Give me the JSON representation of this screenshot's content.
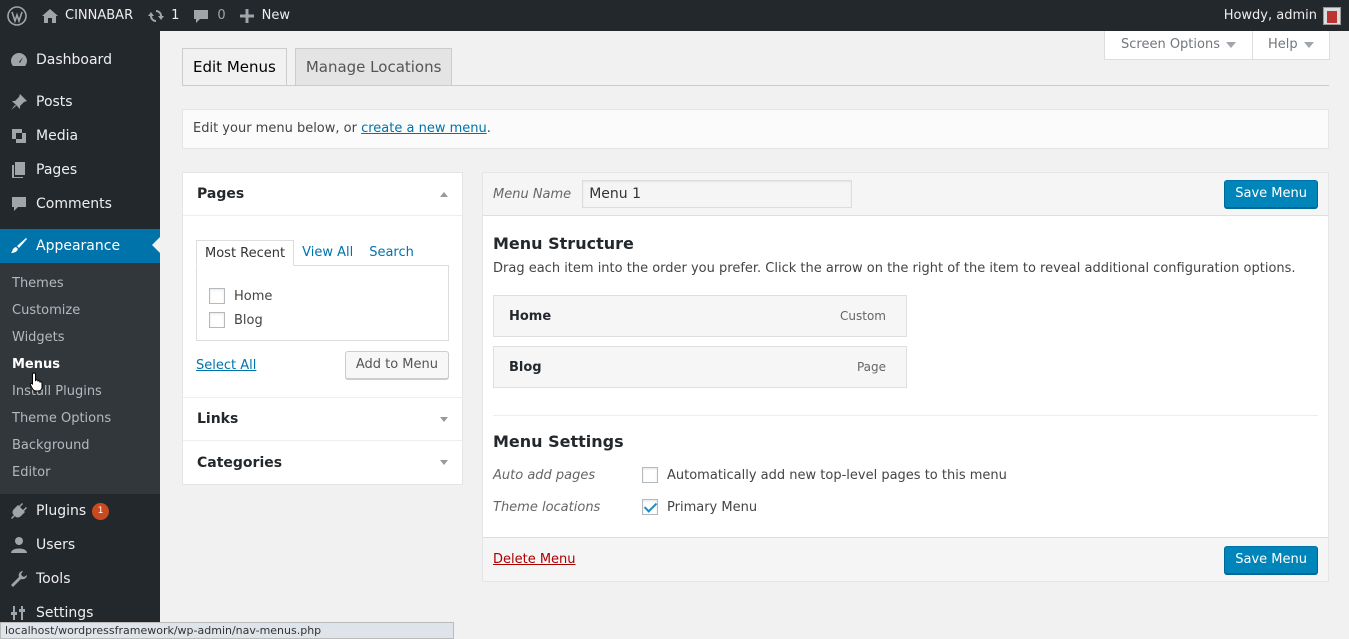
{
  "adminbar": {
    "site_name": "CINNABAR",
    "updates_count": "1",
    "comments_count": "0",
    "new_label": "New",
    "howdy": "Howdy, admin"
  },
  "sidebar": {
    "items": [
      {
        "label": "Dashboard",
        "icon": "dashboard-icon"
      },
      {
        "label": "Posts",
        "icon": "pin-icon"
      },
      {
        "label": "Media",
        "icon": "media-icon"
      },
      {
        "label": "Pages",
        "icon": "pages-icon"
      },
      {
        "label": "Comments",
        "icon": "comment-icon"
      },
      {
        "label": "Appearance",
        "icon": "brush-icon"
      },
      {
        "label": "Plugins",
        "icon": "plugin-icon",
        "badge": "1"
      },
      {
        "label": "Users",
        "icon": "users-icon"
      },
      {
        "label": "Tools",
        "icon": "wrench-icon"
      },
      {
        "label": "Settings",
        "icon": "settings-icon"
      }
    ],
    "submenu": [
      "Themes",
      "Customize",
      "Widgets",
      "Menus",
      "Install Plugins",
      "Theme Options",
      "Background",
      "Editor"
    ]
  },
  "tabs": {
    "edit": "Edit Menus",
    "locations": "Manage Locations"
  },
  "screen_options": "Screen Options",
  "help": "Help",
  "notice": {
    "text": "Edit your menu below, or ",
    "link": "create a new menu",
    "end": "."
  },
  "left": {
    "pages_title": "Pages",
    "tabs": [
      "Most Recent",
      "View All",
      "Search"
    ],
    "pages": [
      "Home",
      "Blog"
    ],
    "select_all": "Select All",
    "add_to_menu": "Add to Menu",
    "links_title": "Links",
    "categories_title": "Categories"
  },
  "menu": {
    "name_label": "Menu Name",
    "name_value": "Menu 1",
    "save": "Save Menu",
    "structure_title": "Menu Structure",
    "structure_desc": "Drag each item into the order you prefer. Click the arrow on the right of the item to reveal additional configuration options.",
    "items": [
      {
        "title": "Home",
        "type": "Custom"
      },
      {
        "title": "Blog",
        "type": "Page"
      }
    ],
    "settings_title": "Menu Settings",
    "auto_add_label": "Auto add pages",
    "auto_add_text": "Automatically add new top-level pages to this menu",
    "auto_add_checked": false,
    "locations_label": "Theme locations",
    "primary_text": "Primary Menu",
    "primary_checked": true,
    "delete": "Delete Menu"
  },
  "status_url": "localhost/wordpressframework/wp-admin/nav-menus.php",
  "colors": {
    "accent": "#0073aa",
    "primary_button": "#0085ba",
    "sidebar": "#23282d",
    "badge": "#ca4a1f"
  }
}
